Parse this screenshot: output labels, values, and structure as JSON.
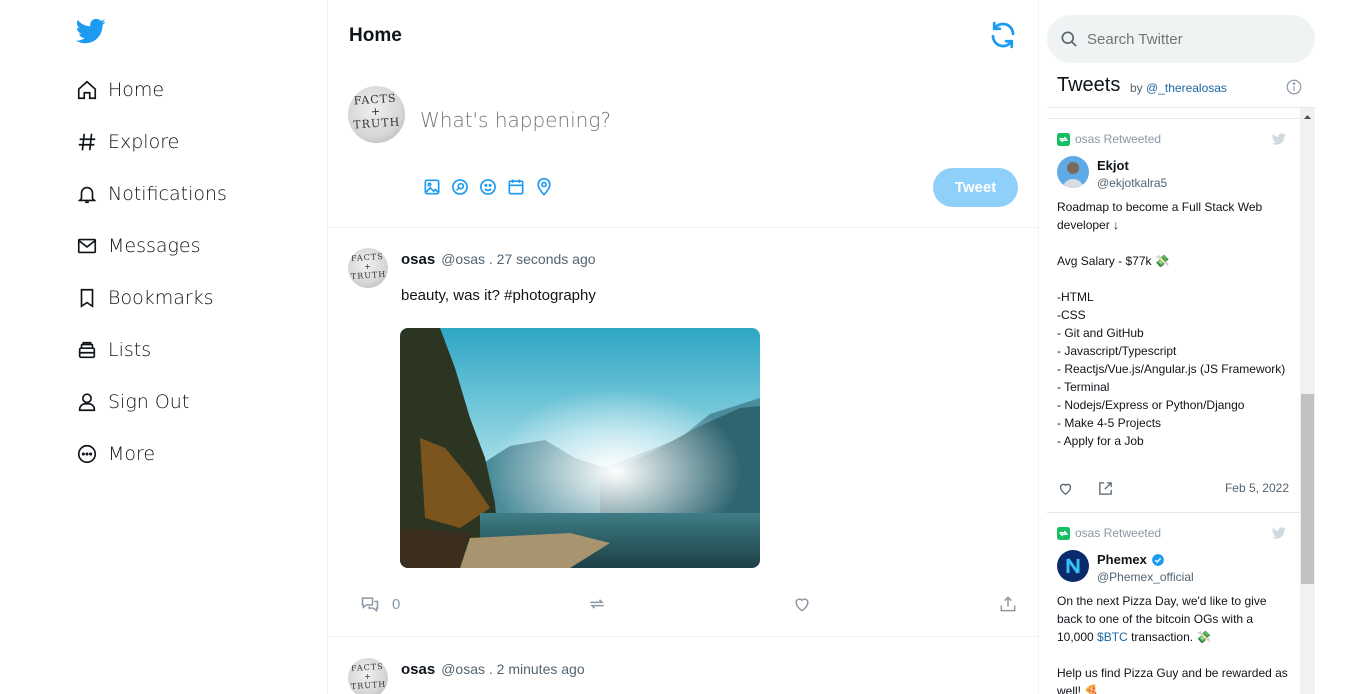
{
  "nav": {
    "items": [
      {
        "label": "Home",
        "icon": "home-icon"
      },
      {
        "label": "Explore",
        "icon": "hashtag-icon"
      },
      {
        "label": "Notifications",
        "icon": "bell-icon"
      },
      {
        "label": "Messages",
        "icon": "mail-icon"
      },
      {
        "label": "Bookmarks",
        "icon": "bookmark-icon"
      },
      {
        "label": "Lists",
        "icon": "list-icon"
      },
      {
        "label": "Sign Out",
        "icon": "person-icon"
      },
      {
        "label": "More",
        "icon": "more-circle-icon"
      }
    ]
  },
  "main": {
    "title": "Home",
    "compose": {
      "placeholder": "What's happening?",
      "tweet_button": "Tweet",
      "avatar_text": "FACTS + TRUTH"
    },
    "posts": [
      {
        "name": "osas",
        "meta": "@osas . 27 seconds ago",
        "text": "beauty, was it? #photography",
        "comment_count": "0",
        "avatar_text": "FACTS + TRUTH"
      },
      {
        "name": "osas",
        "meta": "@osas . 2 minutes ago",
        "avatar_text": "FACTS + TRUTH"
      }
    ]
  },
  "sidebar": {
    "search_placeholder": "Search Twitter",
    "embed": {
      "title": "Tweets",
      "by_label": "by",
      "by_handle": "@_therealosas"
    },
    "tweets": [
      {
        "retweet_label": "osas Retweeted",
        "name": "Ekjot",
        "handle": "@ekjotkalra5",
        "lines": [
          "Roadmap to become a Full Stack Web developer ↓",
          "",
          "Avg Salary - $77k 💸",
          "",
          "-HTML",
          "-CSS",
          "- Git and GitHub",
          "- Javascript/Typescript",
          "- Reactjs/Vue.js/Angular.js (JS Framework)",
          "- Terminal",
          "- Nodejs/Express or Python/Django",
          "- Make 4-5 Projects",
          "- Apply for a Job"
        ],
        "date": "Feb 5, 2022"
      },
      {
        "retweet_label": "osas Retweeted",
        "name": "Phemex",
        "handle": "@Phemex_official",
        "lines_a": "On the next Pizza Day, we'd like to give back to one of the bitcoin OGs with a 10,000 ",
        "cashtag": "$BTC",
        "lines_b": " transaction. 💸",
        "lines_c": "Help us find Pizza Guy and be rewarded as well! 🍕"
      }
    ]
  },
  "colors": {
    "brand": "#1d9bf0",
    "tweet_button": "#8ed0f9",
    "retweet_green": "#17bf63",
    "link": "#1d68a4"
  }
}
